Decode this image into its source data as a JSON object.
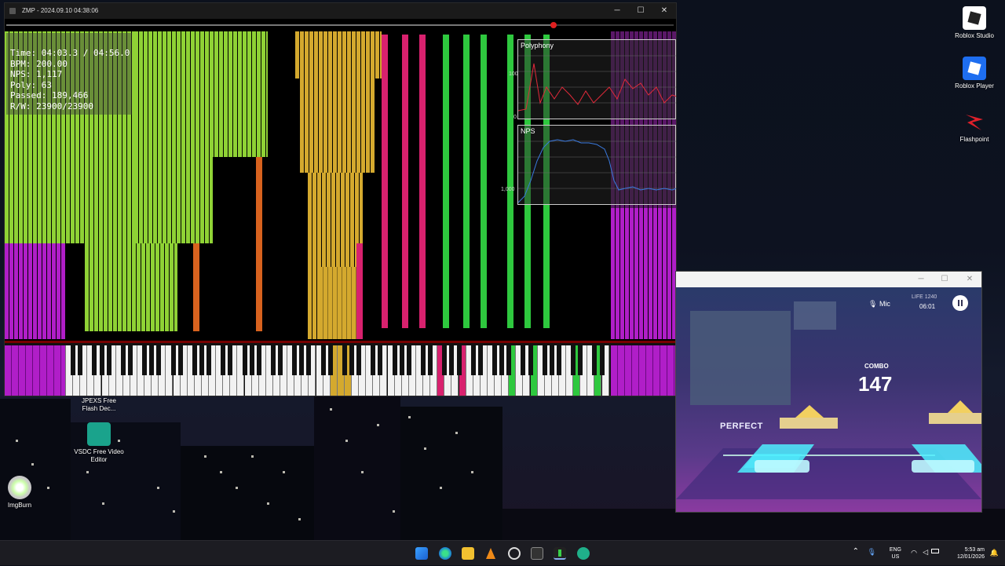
{
  "zmp_window": {
    "title": "ZMP - 2024.09.10 04:38:06",
    "controls": {
      "minimize": "─",
      "maximize": "☐",
      "close": "✕"
    },
    "seek_progress": 0.82
  },
  "stats": {
    "time": "Time: 04:03.3 / 04:56.0",
    "bpm": "BPM: 200.00",
    "nps": "NPS: 1,117",
    "poly": "Poly: 63",
    "passed": "Passed: 189,466",
    "rw": "R/W: 23900/23900"
  },
  "graphs": {
    "polyphony": {
      "title": "Polyphony",
      "y_top": "100",
      "y_bottom": "0"
    },
    "nps": {
      "title": "NPS",
      "y_mid": "1,000"
    }
  },
  "desktop_icons": [
    {
      "label": "Roblox Studio",
      "icon": "roblox-studio-icon"
    },
    {
      "label": "Roblox Player",
      "icon": "roblox-player-icon"
    },
    {
      "label": "Flashpoint",
      "icon": "flashpoint-icon"
    },
    {
      "label": "JPEXS Free Flash Dec...",
      "icon": "jpexs-icon"
    },
    {
      "label": "VSDC Free Video Editor",
      "icon": "vsdc-icon"
    },
    {
      "label": "ImgBurn",
      "icon": "imgburn-icon"
    }
  ],
  "game_window": {
    "controls": {
      "minimize": "─",
      "maximize": "☐",
      "close": "✕"
    },
    "mic_label": "Mic",
    "life_label": "LIFE",
    "life_value": "1240",
    "time": "06:01",
    "combo_label": "COMBO",
    "combo_value": "147",
    "judgement": "PERFECT"
  },
  "taskbar": {
    "apps": [
      "start-icon",
      "edge-icon",
      "file-explorer-icon",
      "vlc-icon",
      "chrome-icon",
      "terminal-icon",
      "zmp-icon",
      "game-icon"
    ],
    "language_top": "ENG",
    "language_bottom": "US",
    "clock_time": "5:53 am",
    "clock_date": "12/01/2026"
  },
  "colors": {
    "green": "#8fd235",
    "gold": "#d4a92e",
    "magenta": "#b01ec8",
    "pink": "#d8216e",
    "bright_green": "#2ec83e",
    "orange": "#d8621e"
  }
}
